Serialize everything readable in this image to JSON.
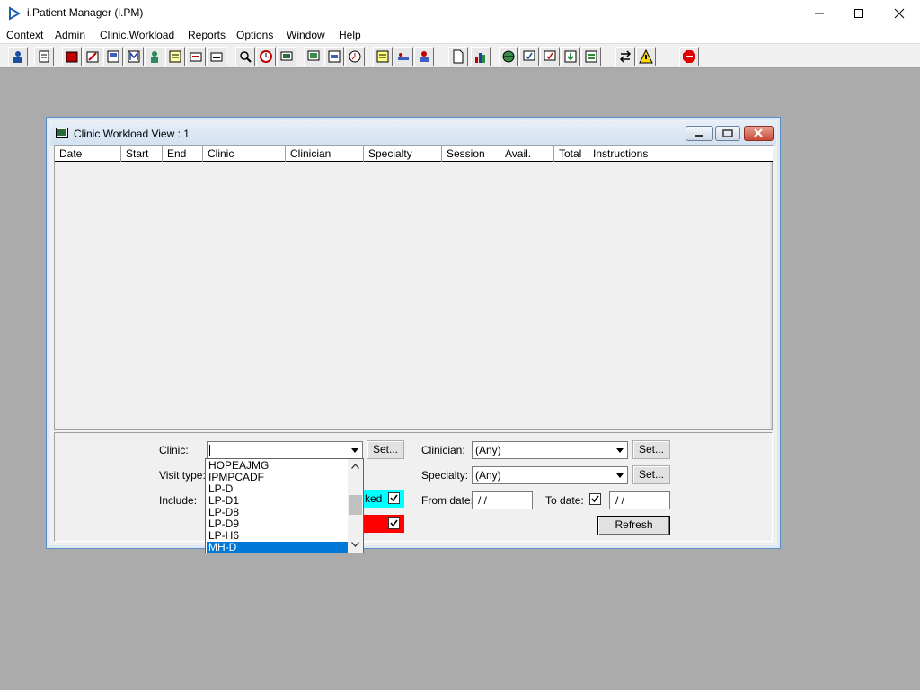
{
  "app": {
    "title": "i.Patient Manager (i.PM)",
    "accent": "#0078d7"
  },
  "window_controls": [
    "minimize-icon",
    "maximize-icon",
    "close-icon"
  ],
  "menu": [
    "Context",
    "Admin",
    "Clinic.Workload",
    "Reports",
    "Options",
    "Window",
    "Help"
  ],
  "toolbar_icons": [
    "user-icon",
    "print-icon",
    "book-icon",
    "edit-icon",
    "form-icon",
    "m-icon",
    "doctor-icon",
    "notes-icon",
    "referral-icon",
    "transfer-icon",
    "search-icon",
    "clock-icon",
    "monitor-icon",
    "screen-icon",
    "document-icon",
    "calendar-icon",
    "notes-icon",
    "bed-icon",
    "patient-icon",
    "page-icon",
    "bar-chart-icon",
    "globe-icon",
    "checklist-icon",
    "checklist-icon",
    "download-icon",
    "sync-icon",
    "swap-icon",
    "warning-icon",
    "exit-icon"
  ],
  "child_window": {
    "title": "Clinic Workload View : 1",
    "columns": [
      "Date",
      "Start",
      "End",
      "Clinic",
      "Clinician",
      "Specialty",
      "Session",
      "Avail.",
      "Total",
      "Instructions"
    ]
  },
  "form": {
    "clinic_label": "Clinic:",
    "clinic_value": "",
    "set_label": "Set...",
    "visit_type_label": "Visit type:",
    "include_label": "Include:",
    "include_booked_text": "ked",
    "include_booked_color": "#00ffff",
    "include_cancelled_color": "#ff0000",
    "clinician_label": "Clinician:",
    "clinician_value": "(Any)",
    "specialty_label": "Specialty:",
    "specialty_value": "(Any)",
    "from_date_label": "From date:",
    "from_date_value": " /  /",
    "to_date_label": "To date:",
    "to_date_value": " /  /",
    "refresh_label": "Refresh"
  },
  "clinic_dropdown": {
    "items": [
      "HOPEAJMG",
      "IPMPCADF",
      "LP-D",
      "LP-D1",
      "LP-D8",
      "LP-D9",
      "LP-H6",
      "MH-D"
    ],
    "selected": "MH-D"
  }
}
